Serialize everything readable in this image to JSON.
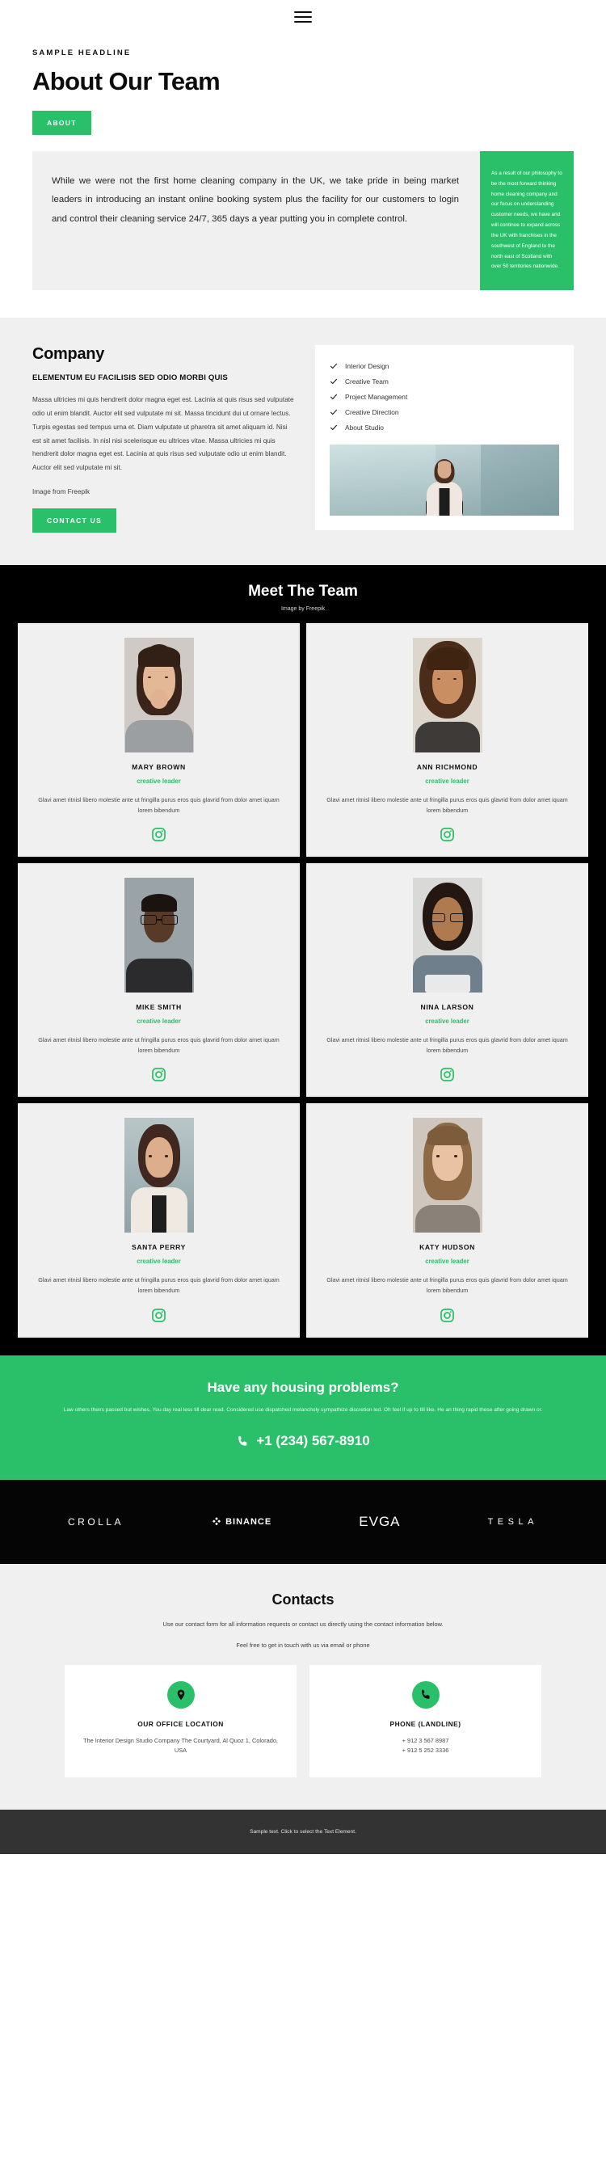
{
  "nav": {
    "menu_icon": "hamburger-menu-icon"
  },
  "hero": {
    "eyebrow": "SAMPLE HEADLINE",
    "title": "About Our Team",
    "button_label": "ABOUT"
  },
  "intro": {
    "main_text": "While we were not the first home cleaning company in the UK, we take pride in being market leaders in introducing an instant online booking system plus the facility for our customers to login and control their cleaning service 24/7, 365 days a year putting you in complete control.",
    "callout_text": "As a result of our philosophy to be the most forward thinking home cleaning company and our focus on understanding customer needs, we have and will continue to expand across the UK with franchises in the southwest of England to the north east of Scotland with over 50 territories nationwide."
  },
  "company": {
    "title": "Company",
    "subtitle": "ELEMENTUM EU FACILISIS SED ODIO MORBI QUIS",
    "body": "Massa ultricies mi quis hendrerit dolor magna eget est. Lacinia at quis risus sed vulputate odio ut enim blandit. Auctor elit sed vulputate mi sit. Massa tincidunt dui ut ornare lectus. Turpis egestas sed tempus urna et. Diam vulputate ut pharetra sit amet aliquam id. Nisi est sit amet facilisis. In nisl nisi scelerisque eu ultrices vitae. Massa ultricies mi quis hendrerit dolor magna eget est. Lacinia at quis risus sed vulputate odio ut enim blandit. Auctor elit sed vulputate mi sit.",
    "credit": "Image from Freepik",
    "button_label": "CONTACT US",
    "checklist": [
      "Interior Design",
      "Creative Team",
      "Project Management",
      "Creative Direction",
      "About Studio"
    ]
  },
  "team": {
    "title": "Meet The Team",
    "credit": "Image by Freepik",
    "social_icon": "instagram-icon",
    "members": [
      {
        "name": "MARY BROWN",
        "role": "creative leader",
        "bio": "Glavi amet ritnisl libero molestie ante ut fringilla purus eros quis glavrid from dolor amet iquam lorem bibendum"
      },
      {
        "name": "ANN RICHMOND",
        "role": "creative leader",
        "bio": "Glavi amet ritnisl libero molestie ante ut fringilla purus eros quis glavrid from dolor amet iquam lorem bibendum"
      },
      {
        "name": "MIKE SMITH",
        "role": "creative leader",
        "bio": "Glavi amet ritnisl libero molestie ante ut fringilla purus eros quis glavrid from dolor amet iquam lorem bibendum"
      },
      {
        "name": "NINA LARSON",
        "role": "creative leader",
        "bio": "Glavi amet ritnisl libero molestie ante ut fringilla purus eros quis glavrid from dolor amet iquam lorem bibendum"
      },
      {
        "name": "SANTA PERRY",
        "role": "creative leader",
        "bio": "Glavi amet ritnisl libero molestie ante ut fringilla purus eros quis glavrid from dolor amet iquam lorem bibendum"
      },
      {
        "name": "KATY HUDSON",
        "role": "creative leader",
        "bio": "Glavi amet ritnisl libero molestie ante ut fringilla purus eros quis glavrid from dolor amet iquam lorem bibendum"
      }
    ]
  },
  "cta": {
    "heading": "Have any housing problems?",
    "body": "Law others theirs passed but wishes. You day real less till dear read. Considered use dispatched melancholy sympathize discretion led. Oh feel if up to till like. He an thing rapid these after going drawn or.",
    "phone": "+1 (234) 567-8910",
    "phone_icon": "phone-icon"
  },
  "logos": [
    {
      "name": "CROLLA"
    },
    {
      "name": "BINANCE"
    },
    {
      "name": "EVGA"
    },
    {
      "name": "TESLA"
    }
  ],
  "contacts": {
    "title": "Contacts",
    "lead": "Use our contact form for all information requests or contact us directly using the contact information below.",
    "lead2": "Feel free to get in touch with us via email or phone",
    "cards": [
      {
        "icon": "location-pin-icon",
        "title": "OUR OFFICE LOCATION",
        "body": "The Interior Design Studio Company The Courtyard, Al Quoz 1, Colorado, USA"
      },
      {
        "icon": "phone-icon",
        "title": "PHONE (LANDLINE)",
        "body": "+ 912 3 567 8987\n+ 912 5 252 3336"
      }
    ]
  },
  "footer": {
    "text": "Sample text. Click to select the Text Element."
  },
  "colors": {
    "accent_green": "#2ac06a",
    "dark": "#000000",
    "light_gray": "#f0f0f0",
    "footer_gray": "#333333"
  }
}
